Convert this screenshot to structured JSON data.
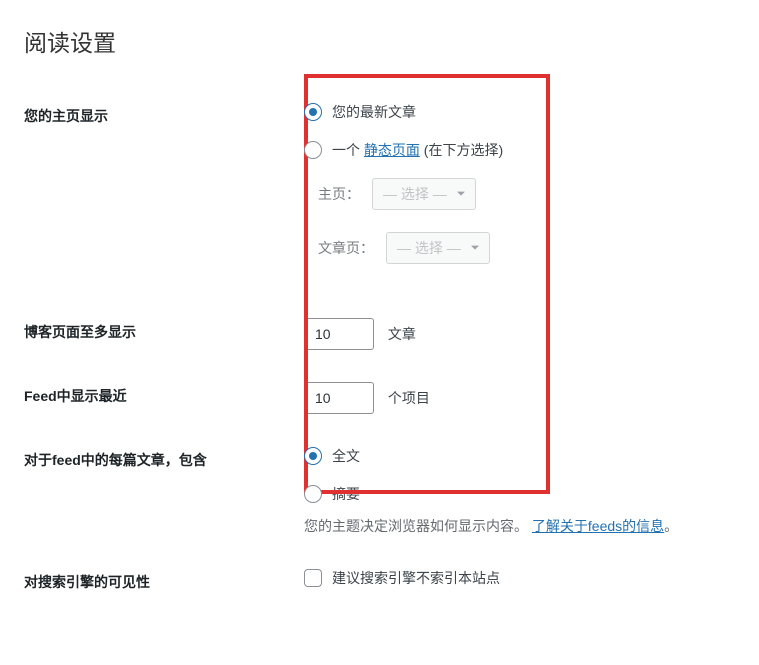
{
  "page_title": "阅读设置",
  "rows": {
    "homepage": {
      "label": "您的主页显示",
      "option_latest": "您的最新文章",
      "option_static_prefix": "一个 ",
      "option_static_link": "静态页面",
      "option_static_suffix": " (在下方选择)",
      "homepage_select_label": "主页：",
      "postspage_select_label": "文章页：",
      "select_placeholder": "— 选择 —"
    },
    "posts_per_page": {
      "label": "博客页面至多显示",
      "value": "10",
      "suffix": "文章"
    },
    "feed_items": {
      "label": "Feed中显示最近",
      "value": "10",
      "suffix": "个项目"
    },
    "feed_content": {
      "label": "对于feed中的每篇文章，包含",
      "option_full": "全文",
      "option_summary": "摘要",
      "description_prefix": "您的主题决定浏览器如何显示内容。",
      "description_link": "了解关于feeds的信息",
      "description_suffix": "。"
    },
    "search_visibility": {
      "label": "对搜索引擎的可见性",
      "checkbox_label": "建议搜索引擎不索引本站点"
    }
  }
}
